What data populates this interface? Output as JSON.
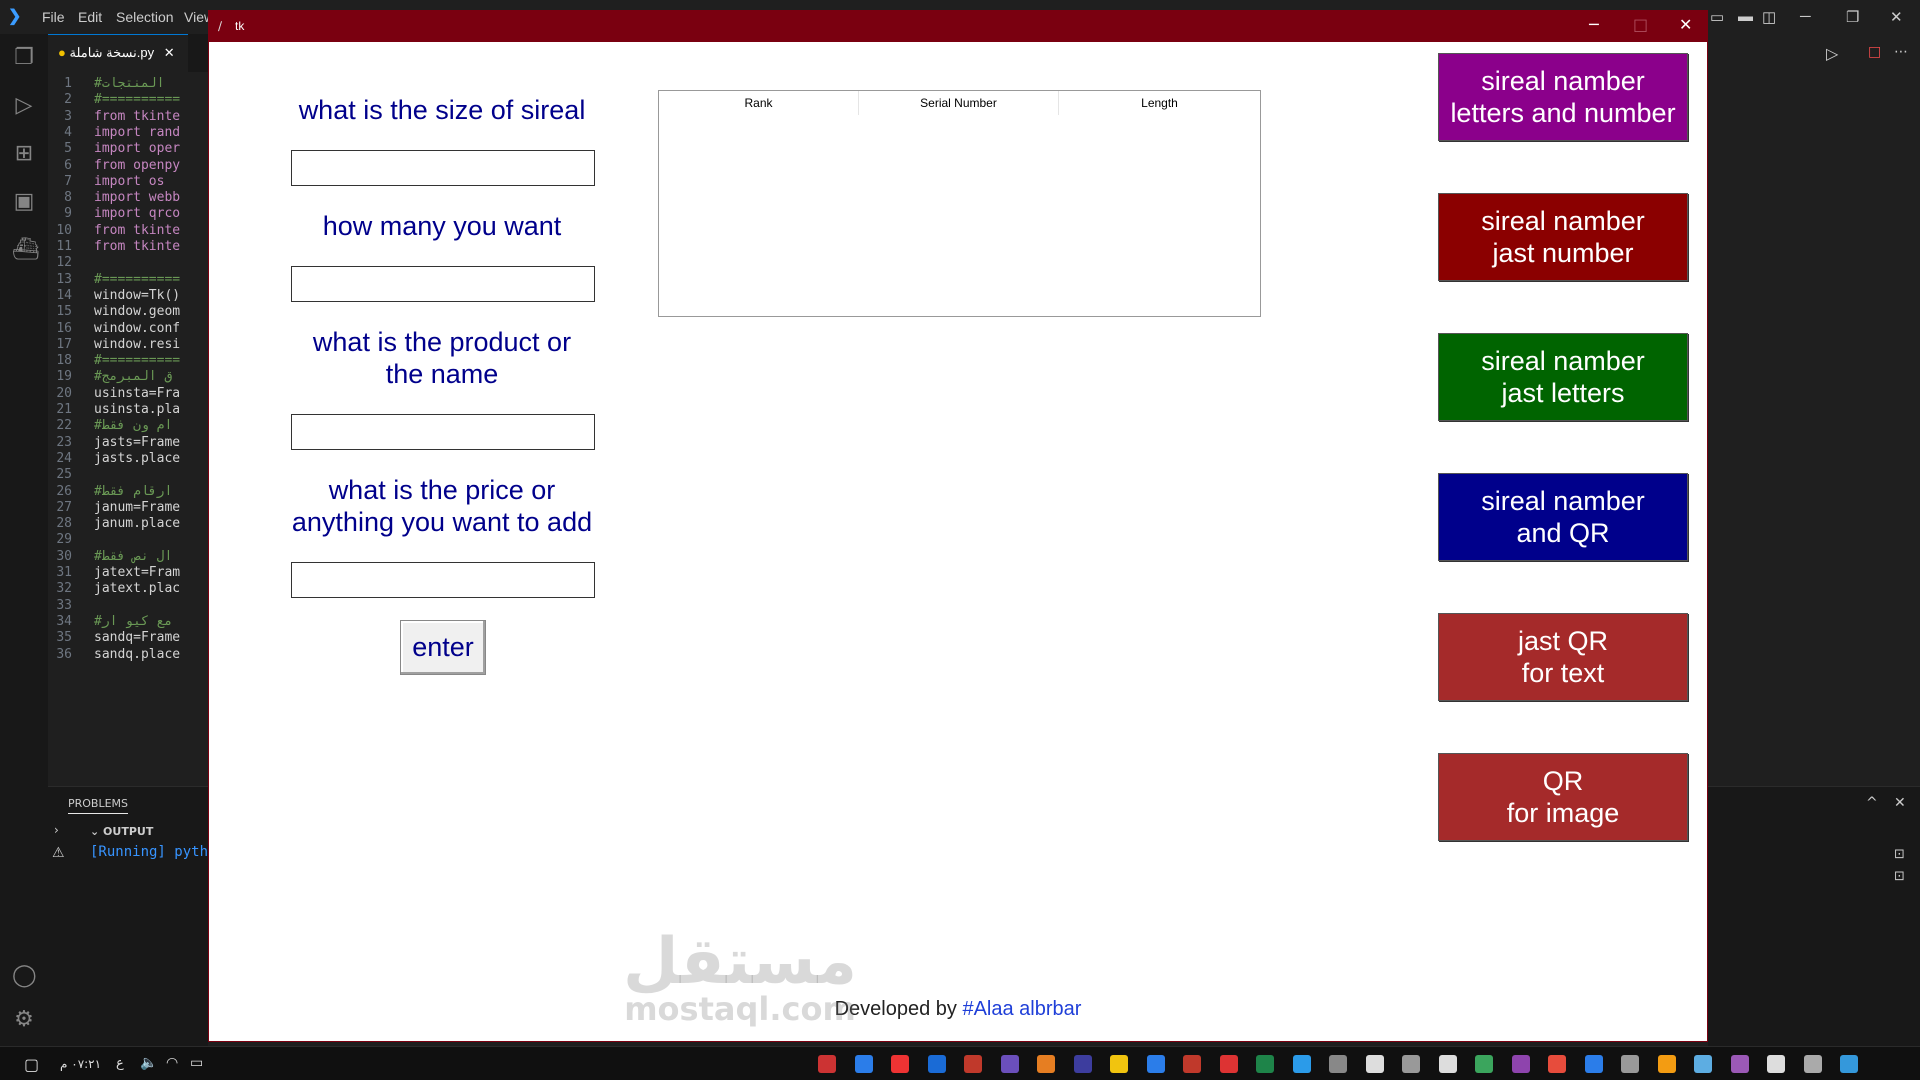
{
  "vscode": {
    "menu": [
      "File",
      "Edit",
      "Selection",
      "View"
    ],
    "tab_label": "نسخة شاملة.py",
    "code_lines": [
      {
        "n": "1",
        "text": "#المنتجات",
        "cls": "cm"
      },
      {
        "n": "2",
        "text": "#==========",
        "cls": "cm"
      },
      {
        "n": "3",
        "text": "from tkinte",
        "cls": "kw"
      },
      {
        "n": "4",
        "text": "import rand",
        "cls": "kw"
      },
      {
        "n": "5",
        "text": "import oper",
        "cls": "kw"
      },
      {
        "n": "6",
        "text": "from openpy",
        "cls": "kw"
      },
      {
        "n": "7",
        "text": "import os",
        "cls": "kw"
      },
      {
        "n": "8",
        "text": "import webb",
        "cls": "kw"
      },
      {
        "n": "9",
        "text": "import qrco",
        "cls": "kw"
      },
      {
        "n": "10",
        "text": "from tkinte",
        "cls": "kw"
      },
      {
        "n": "11",
        "text": "from tkinte",
        "cls": "kw"
      },
      {
        "n": "12",
        "text": "",
        "cls": "tx"
      },
      {
        "n": "13",
        "text": "#==========",
        "cls": "cm"
      },
      {
        "n": "14",
        "text": "window=Tk()",
        "cls": "tx"
      },
      {
        "n": "15",
        "text": "window.geom",
        "cls": "tx"
      },
      {
        "n": "16",
        "text": "window.conf",
        "cls": "tx"
      },
      {
        "n": "17",
        "text": "window.resi",
        "cls": "tx"
      },
      {
        "n": "18",
        "text": "#==========",
        "cls": "cm"
      },
      {
        "n": "19",
        "text": "#ق المبرمج",
        "cls": "cm"
      },
      {
        "n": "20",
        "text": "usinsta=Fra",
        "cls": "tx"
      },
      {
        "n": "21",
        "text": "usinsta.pla",
        "cls": "tx"
      },
      {
        "n": "22",
        "text": "#ام ون فقط",
        "cls": "cm"
      },
      {
        "n": "23",
        "text": "jasts=Frame",
        "cls": "tx"
      },
      {
        "n": "24",
        "text": "jasts.place",
        "cls": "tx"
      },
      {
        "n": "25",
        "text": "",
        "cls": "tx"
      },
      {
        "n": "26",
        "text": "#ارقام فقط",
        "cls": "cm"
      },
      {
        "n": "27",
        "text": "janum=Frame",
        "cls": "tx"
      },
      {
        "n": "28",
        "text": "janum.place",
        "cls": "tx"
      },
      {
        "n": "29",
        "text": "",
        "cls": "tx"
      },
      {
        "n": "30",
        "text": "#ال نص فقط",
        "cls": "cm"
      },
      {
        "n": "31",
        "text": "jatext=Fram",
        "cls": "tx"
      },
      {
        "n": "32",
        "text": "jatext.plac",
        "cls": "tx"
      },
      {
        "n": "33",
        "text": "",
        "cls": "tx"
      },
      {
        "n": "34",
        "text": "#مع كيو ار",
        "cls": "cm"
      },
      {
        "n": "35",
        "text": "sandq=Frame",
        "cls": "tx"
      },
      {
        "n": "36",
        "text": "sandq.place",
        "cls": "tx"
      }
    ],
    "panel_tab": "PROBLEMS",
    "output_label": "OUTPUT",
    "running_text": "[Running] pyth"
  },
  "taskbar": {
    "clock": "٠٧:٢١ م",
    "lang": "ع"
  },
  "tk_window": {
    "title": "tk",
    "labels": {
      "size": "what is the size of sireal",
      "count": "how many you want",
      "product_l1": "what is the product or",
      "product_l2": "the name",
      "price_l1": "what is the price or",
      "price_l2": "anything you want to add"
    },
    "enter_label": "enter",
    "table_headers": [
      "Rank",
      "Serial Number",
      "Length"
    ],
    "buttons": [
      {
        "line1": "sireal namber",
        "line2": "letters and number",
        "color": "#8b008b"
      },
      {
        "line1": "sireal namber",
        "line2": "jast number",
        "color": "#8b0000"
      },
      {
        "line1": "sireal namber",
        "line2": "jast letters",
        "color": "#006400"
      },
      {
        "line1": "sireal namber",
        "line2": "and QR",
        "color": "#00008b"
      },
      {
        "line1": "jast QR",
        "line2": "for text",
        "color": "#a52a2a"
      },
      {
        "line1": "QR",
        "line2": "for image",
        "color": "#a52a2a"
      }
    ],
    "footer_prefix": "Developed by",
    "footer_author": "#Alaa albrbar"
  },
  "watermark": {
    "line1": "مستقل",
    "line2": "mostaql.com"
  }
}
